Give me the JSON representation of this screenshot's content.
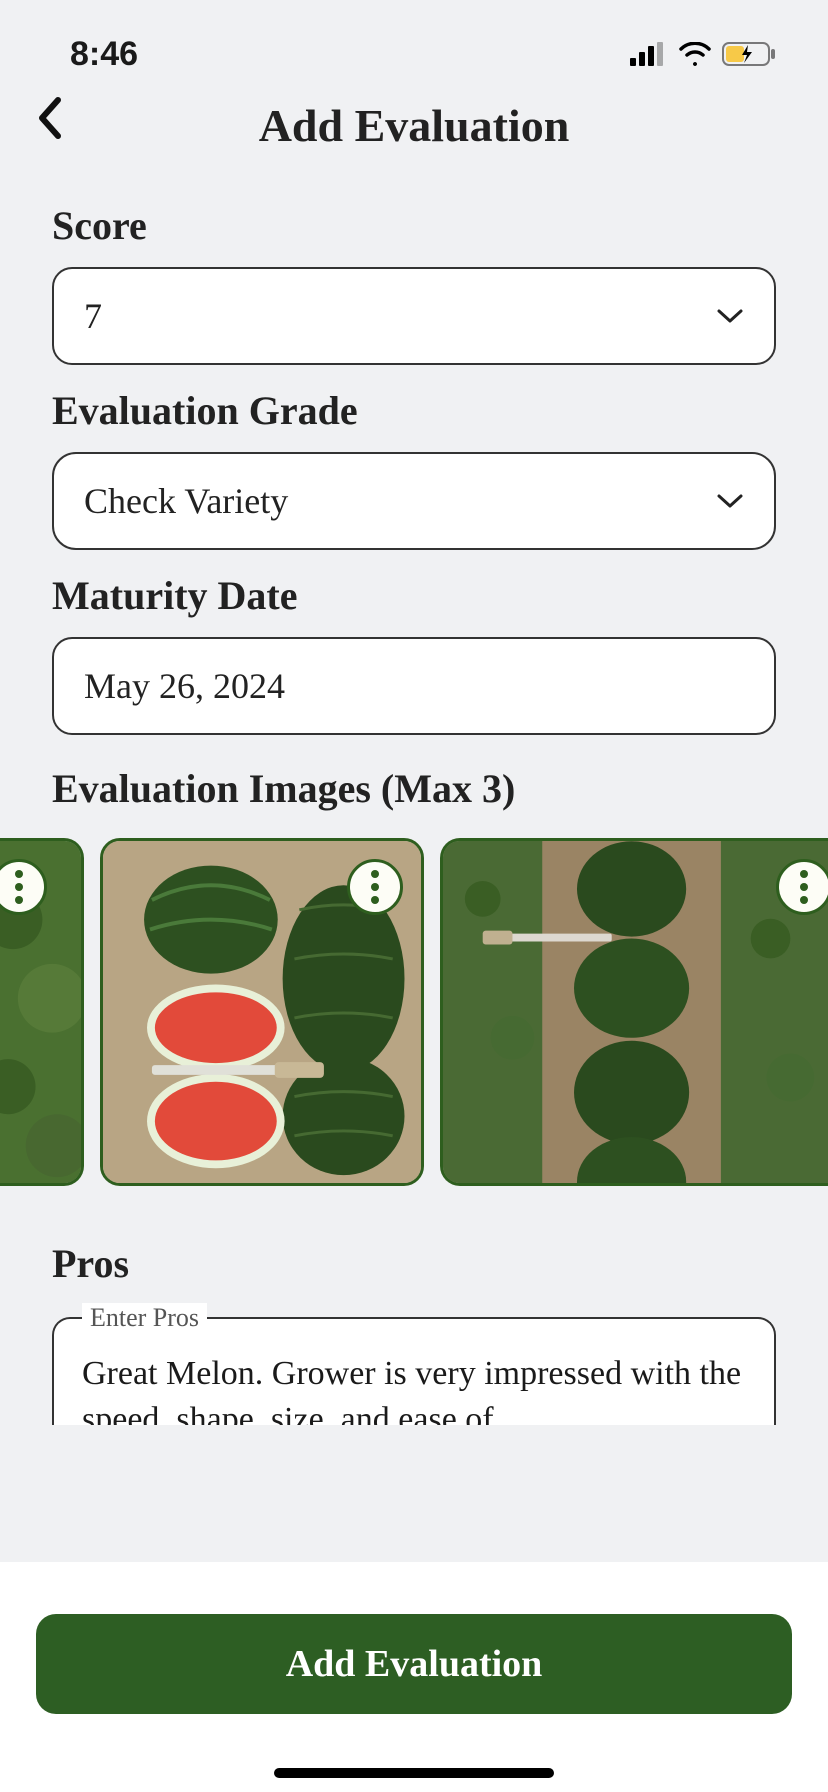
{
  "status_bar": {
    "time": "8:46"
  },
  "header": {
    "title": "Add Evaluation"
  },
  "fields": {
    "score": {
      "label": "Score",
      "value": "7"
    },
    "grade": {
      "label": "Evaluation Grade",
      "value": "Check Variety"
    },
    "maturity": {
      "label": "Maturity Date",
      "value": "May 26, 2024"
    },
    "images": {
      "label": "Evaluation Images (Max 3)"
    },
    "pros": {
      "label": "Pros",
      "legend": "Enter Pros",
      "value": "Great Melon. Grower is very impressed with the speed, shape, size, and ease of"
    }
  },
  "button": {
    "submit": "Add Evaluation"
  },
  "colors": {
    "accent": "#2d5e23",
    "border_dark": "#2e5e1e"
  }
}
